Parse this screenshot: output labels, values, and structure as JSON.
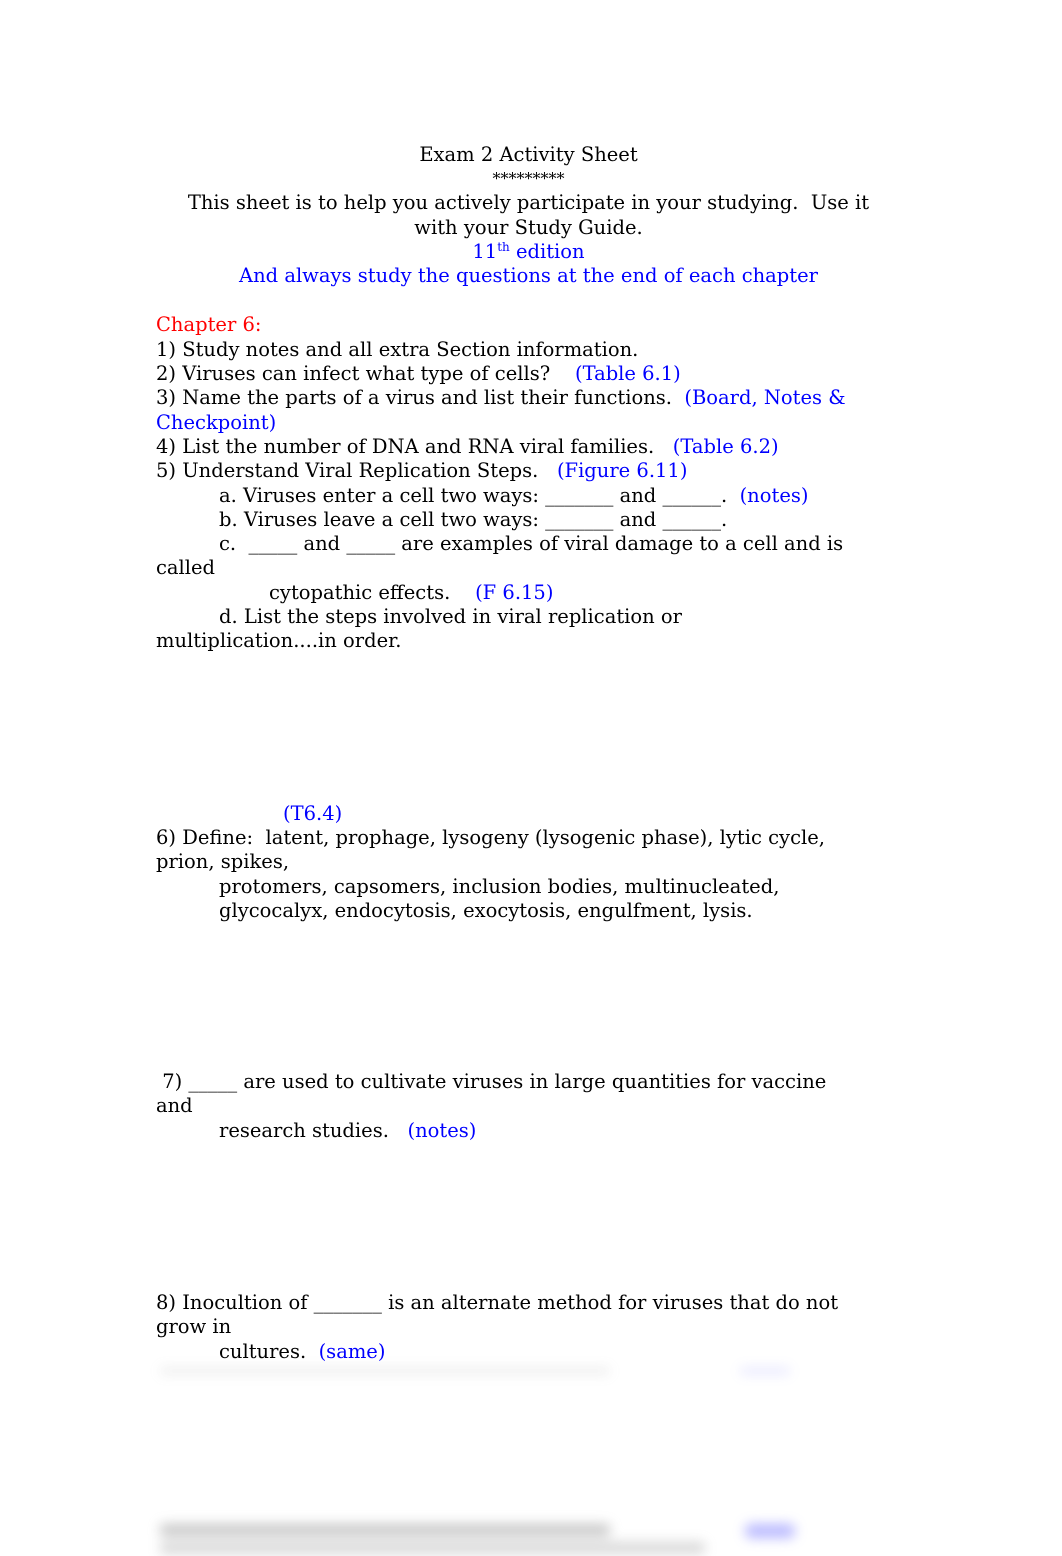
{
  "header": {
    "title": "Exam 2 Activity Sheet",
    "stars": "*********",
    "intro_line1": "This sheet is to help you actively participate in your studying.  Use it",
    "intro_line2": "with your Study Guide.",
    "edition_num": "11",
    "edition_sup": "th",
    "edition_text": " edition",
    "reminder": "And always study the questions at the end of each chapter"
  },
  "chapter": {
    "heading": "Chapter 6:",
    "items": {
      "q1": "1) Study notes and all extra Section information.",
      "q2": "2) Viruses can infect what type of cells?    ",
      "q2_ref": "(Table 6.1)",
      "q3": "3) Name the parts of a virus and list their functions.  ",
      "q3_ref_a": "(Board, Notes &",
      "q3_ref_b": "Checkpoint)",
      "q4": "4) List the number of DNA and RNA viral families.   ",
      "q4_ref": "(Table 6.2)",
      "q5": "5) Understand Viral Replication Steps.   ",
      "q5_ref": "(Figure 6.11)",
      "q5a": "a. Viruses enter a cell two ways: _______ and ______.  ",
      "q5a_ref": "(notes)",
      "q5b": "b. Viruses leave a cell two ways: _______ and ______.",
      "q5c_a": "c.  _____ and _____ are examples of viral damage to a cell and is",
      "q5c_b": "called",
      "q5c_c": "cytopathic effects.    ",
      "q5c_ref": "(F 6.15)",
      "q5d_a": "d. List the steps involved in viral replication or",
      "q5d_b": "multiplication....in order.",
      "q5d_ref": "(T6.4)",
      "q6_a": "6) Define:  latent, prophage, lysogeny (lysogenic phase), lytic cycle,",
      "q6_b": "prion, spikes,",
      "q6_c": "protomers, capsomers, inclusion bodies, multinucleated,",
      "q6_d": "glycocalyx, endocytosis, exocytosis, engulfment, lysis.",
      "q7_a": " 7) _____ are used to cultivate viruses in large quantities for vaccine",
      "q7_b": "and",
      "q7_c": "research studies.   ",
      "q7_ref": "(notes)",
      "q8_a": "8) Inocultion of _______ is an alternate method for viruses that do not",
      "q8_b": "grow in",
      "q8_c": "cultures.  ",
      "q8_ref": "(same)"
    }
  },
  "colors": {
    "reference_blue": "#0000ff",
    "heading_red": "#ff0000"
  }
}
